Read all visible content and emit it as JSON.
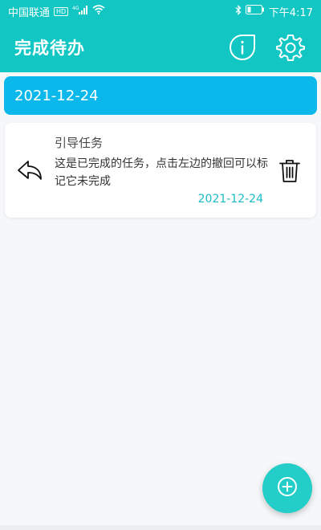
{
  "status_bar": {
    "carrier": "中国联通",
    "network_badge": "HD",
    "signal_label": "4G",
    "time": "下午4:17",
    "icons": [
      "signal-icon",
      "wifi-icon",
      "bluetooth-icon",
      "battery-icon"
    ]
  },
  "app_bar": {
    "title": "完成待办",
    "icons": [
      "info-icon",
      "settings-gear-icon"
    ],
    "background_color": "#12c7c3"
  },
  "date_group": {
    "date": "2021-12-24",
    "background_color": "#0ab8eb"
  },
  "tasks": [
    {
      "title": "引导任务",
      "description": "这是已完成的任务，点击左边的撤回可以标记它未完成",
      "date": "2021-12-24",
      "left_icon": "undo-arrow-icon",
      "right_icon": "trash-icon"
    }
  ],
  "fab": {
    "icon": "add-circle-icon",
    "color": "#23cdc8"
  }
}
